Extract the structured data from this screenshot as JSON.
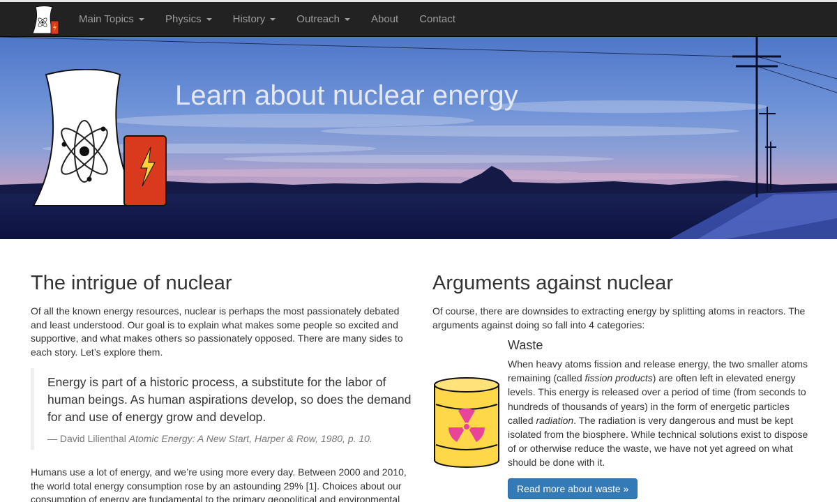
{
  "nav": {
    "items": [
      {
        "label": "Main Topics",
        "dropdown": true
      },
      {
        "label": "Physics",
        "dropdown": true
      },
      {
        "label": "History",
        "dropdown": true
      },
      {
        "label": "Outreach",
        "dropdown": true
      },
      {
        "label": "About",
        "dropdown": false
      },
      {
        "label": "Contact",
        "dropdown": false
      }
    ]
  },
  "hero": {
    "title": "Learn about nuclear energy"
  },
  "left": {
    "heading": "The intrigue of nuclear",
    "intro": "Of all the known energy resources, nuclear is perhaps the most passionately debated and least understood. Our goal is to explain what makes some people so excited and supportive, and what makes others so passionately opposed. There are many sides to each story. Let’s explore them.",
    "quote": "Energy is part of a historic process, a substitute for the labor of human beings. As human aspirations develop, so does the demand for and use of energy grow and develop.",
    "quote_author": "— David Lilienthal",
    "quote_source": "Atomic Energy: A New Start, Harper & Row, 1980, p. 10.",
    "para2": "Humans use a lot of energy, and we’re using more every day. Between 2000 and 2010, the world total energy consumption rose by an astounding 29% [1]. Choices about our consumption of energy are fundamental to the primary geopolitical and environmental"
  },
  "right": {
    "heading": "Arguments against nuclear",
    "intro": "Of course, there are downsides to extracting energy by splitting atoms in reactors. The arguments against doing so fall into 4 categories:",
    "waste": {
      "title": "Waste",
      "text_1": "When heavy atoms fission and release energy, the two smaller atoms remaining (called ",
      "term_1": "fission products",
      "text_2": ") are often left in elevated energy levels. This energy is released over a period of time (from seconds to hundreds of thousands of years) in the form of energetic particles called ",
      "term_2": "radiation",
      "text_3": ". The radiation is very dangerous and must be kept isolated from the biosphere. While technical solutions exist to dispose of or otherwise reduce the waste, we have not yet agreed on what should be done with it.",
      "button": "Read more about waste »"
    }
  },
  "colors": {
    "navbar": "#222222",
    "nav_text": "#9d9d9d",
    "button": "#337ab7",
    "barrel": "#ffd84a",
    "trefoil": "#e8449a",
    "logo_red": "#d93a1e"
  },
  "icons": {
    "logo": "cooling-tower-atom-logo",
    "hero_logo": "cooling-tower-atom-icon",
    "waste": "radioactive-barrel-icon"
  }
}
